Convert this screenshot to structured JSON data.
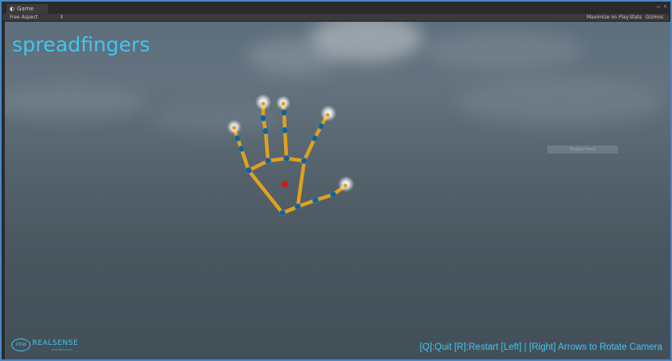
{
  "window": {
    "tab_label": "Game",
    "tab_icon": "unity-icon",
    "toolbar": {
      "aspect": "Free Aspect",
      "maximize": "Maximize on Play",
      "stats": "Stats",
      "gizmos": "Gizmos"
    }
  },
  "game": {
    "title": "spreadfingers",
    "help_text": "[Q]:Quit [R]:Restart [Left] | [Right] Arrows to Rotate Camera",
    "ghost_button": "Enable Hand",
    "logo": {
      "brand": "intel",
      "product": "REALSENSE",
      "tagline": "TECHNOLOGY"
    }
  },
  "colors": {
    "accent": "#3fc6f0",
    "bone": "#e0a020",
    "joint": "#1b5f8e",
    "palm_center": "#d01818"
  }
}
